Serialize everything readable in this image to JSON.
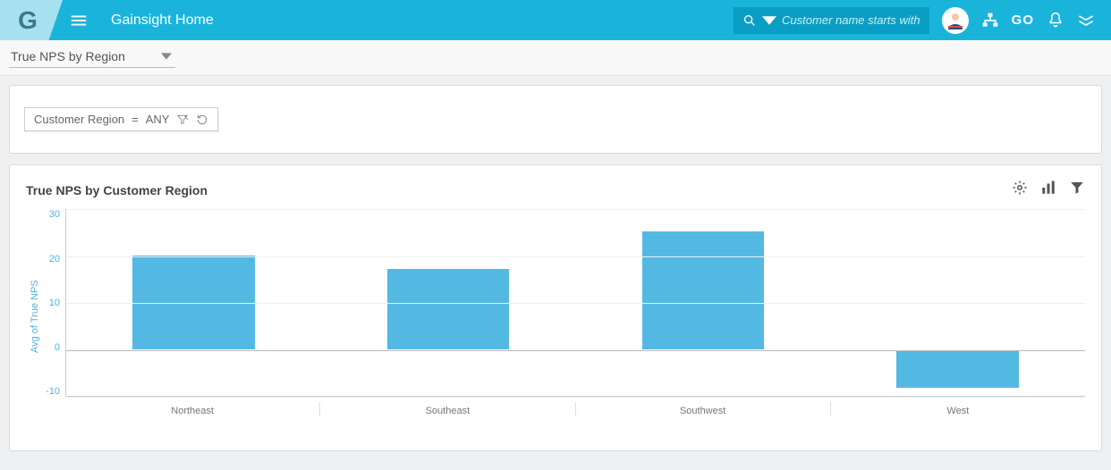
{
  "header": {
    "logo_letter": "G",
    "page_title": "Gainsight Home",
    "search_placeholder": "Customer name starts with",
    "go_label": "GO"
  },
  "selector": {
    "report_name": "True NPS by Region"
  },
  "filter": {
    "field": "Customer Region",
    "operator": "=",
    "value": "ANY"
  },
  "chart": {
    "title": "True NPS by Customer Region"
  },
  "chart_data": {
    "type": "bar",
    "categories": [
      "Northeast",
      "Southeast",
      "Southwest",
      "West"
    ],
    "values": [
      20,
      17,
      25,
      -8
    ],
    "title": "True NPS by Customer Region",
    "xlabel": "",
    "ylabel": "Avg of True NPS",
    "ylim": [
      -10,
      30
    ],
    "yticks": [
      -10,
      0,
      10,
      20,
      30
    ]
  }
}
